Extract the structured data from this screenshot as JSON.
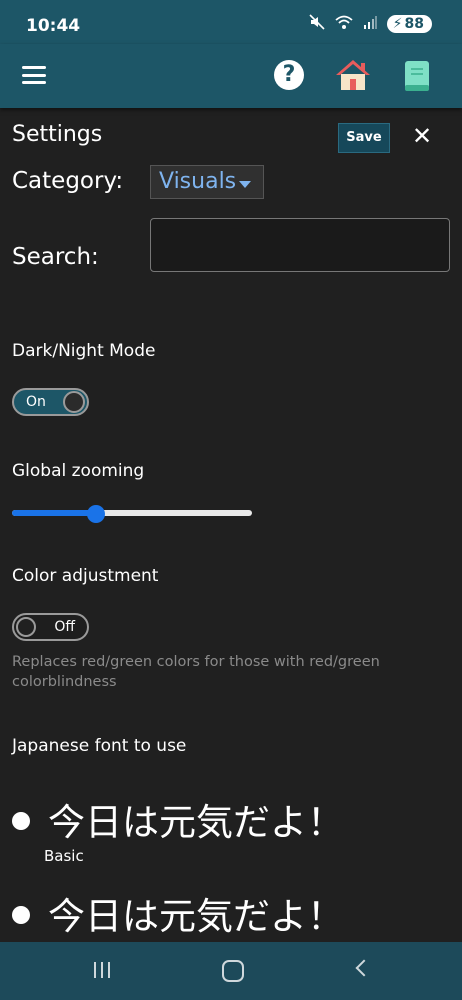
{
  "status_bar": {
    "time": "10:44",
    "battery": "88",
    "icons": [
      "mute-icon",
      "wifi-icon",
      "signal-icon",
      "battery-icon"
    ]
  },
  "appbar": {
    "icons": [
      "menu-icon",
      "help-icon",
      "home-icon",
      "book-icon"
    ],
    "help_glyph": "?"
  },
  "settings": {
    "title": "Settings",
    "save_label": "Save",
    "close_glyph": "✕",
    "category_label": "Category:",
    "category_value": "Visuals",
    "search_label": "Search:",
    "search_value": ""
  },
  "dark_mode": {
    "label": "Dark/Night Mode",
    "state": "On"
  },
  "zoom": {
    "label": "Global zooming",
    "level": 0.35
  },
  "color_adjustment": {
    "label": "Color adjustment",
    "state": "Off",
    "hint": "Replaces red/green colors for those with red/green colorblindness"
  },
  "japanese_font": {
    "label": "Japanese font to use",
    "options": [
      {
        "sample": "今日は元気だよ！",
        "name": "Basic"
      },
      {
        "sample": "今日は元気だよ！"
      }
    ]
  },
  "colors": {
    "accent": "#1d5667",
    "slider": "#1a73e8",
    "link": "#7fb4ef"
  }
}
